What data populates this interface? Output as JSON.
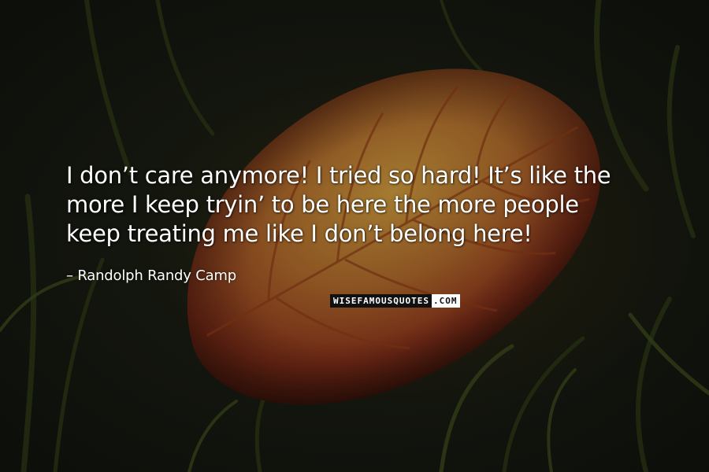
{
  "quote": {
    "line1": "I don’t care anymore! I tried so hard! It’s like the",
    "line2": "more I keep tryin’ to be here the more people",
    "line3": "keep treating me like I don’t belong here!"
  },
  "author": {
    "bullet": "–",
    "name": "Randolph Randy Camp"
  },
  "watermark": {
    "part1": "WISEFAMOUSQUOTES",
    "part2": ".COM"
  },
  "colors": {
    "text": "#ffffff",
    "leaf_center": "#b8802c",
    "leaf_edge": "#8a2c12",
    "grass": "#3c4a1c",
    "background": "#12150e"
  }
}
